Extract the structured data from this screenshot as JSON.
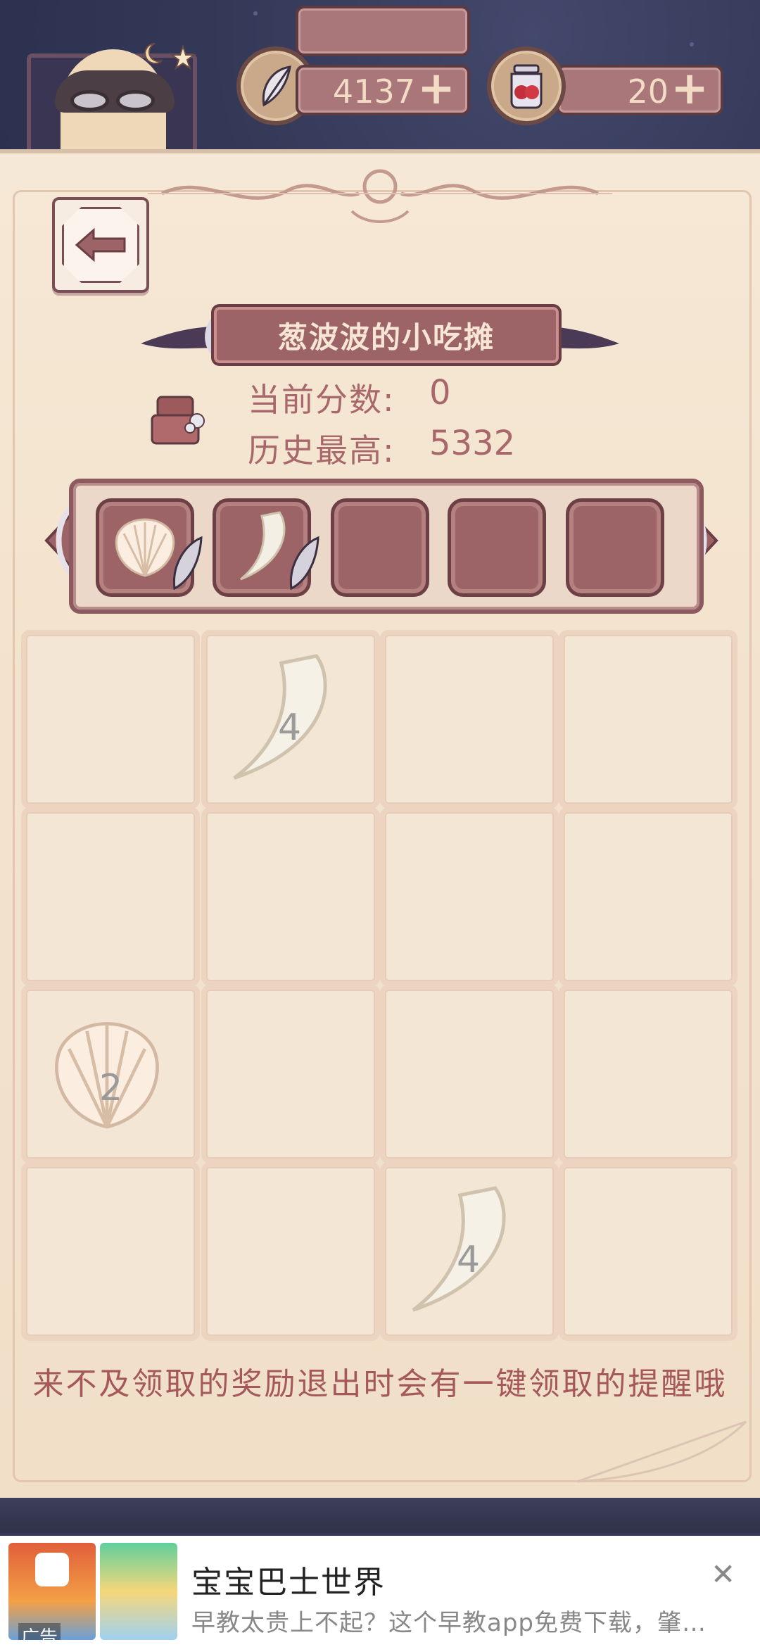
{
  "header": {
    "feather_currency": "4137",
    "jar_currency": "20",
    "plus_glyph": "+"
  },
  "game": {
    "title": "葱波波的小吃摊",
    "current_score_label": "当前分数:",
    "current_score": "0",
    "high_score_label": "历史最高:",
    "high_score": "5332",
    "slots": [
      "shell",
      "tooth",
      "",
      "",
      ""
    ],
    "board_rows": [
      [
        "",
        "tooth 4",
        "",
        ""
      ],
      [
        "",
        "",
        "",
        ""
      ],
      [
        "shell 2",
        "",
        "",
        ""
      ],
      [
        "",
        "",
        "tooth 4",
        ""
      ]
    ],
    "tile_values": {
      "r0c1": "4",
      "r2c0": "2",
      "r3c2": "4"
    },
    "hint": "来不及领取的奖励退出时会有一键领取的提醒哦"
  },
  "ad": {
    "title": "宝宝巴士世界",
    "description": "早教太贵上不起？这个早教app免费下载，肇…",
    "tag": "广告",
    "close_glyph": "✕"
  },
  "colors": {
    "panel": "#f3e3cd",
    "accent": "#9c6466",
    "text": "#a8686b"
  }
}
